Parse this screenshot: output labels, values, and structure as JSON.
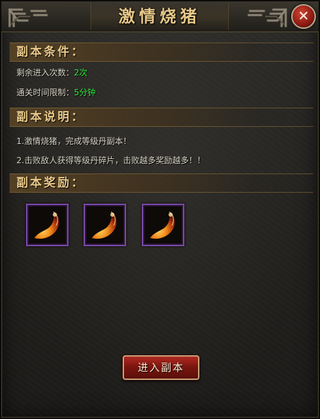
{
  "window": {
    "title": "激情烧猪",
    "close_label": "✕"
  },
  "conditions": {
    "header": "副本条件：",
    "remaining_label": "剩余进入次数：",
    "remaining_value": "2次",
    "time_limit_label": "通关时间限制：",
    "time_limit_value": "5分钟"
  },
  "description": {
    "header": "副本说明：",
    "lines": [
      "1.激情烧猪，完成等级丹副本！",
      "2.击败敌人获得等级丹碎片，击败越多奖励越多！！"
    ]
  },
  "rewards": {
    "header": "副本奖励：",
    "items": [
      {
        "icon": "level-pill-fragment-icon"
      },
      {
        "icon": "level-pill-fragment-icon"
      },
      {
        "icon": "level-pill-fragment-icon"
      }
    ]
  },
  "enter_button": {
    "label": "进入副本"
  },
  "colors": {
    "highlight_value": "#2dea3a",
    "header_text": "#e9c98b",
    "slot_border": "#7a4aa8",
    "button_red": "#7c1610"
  }
}
